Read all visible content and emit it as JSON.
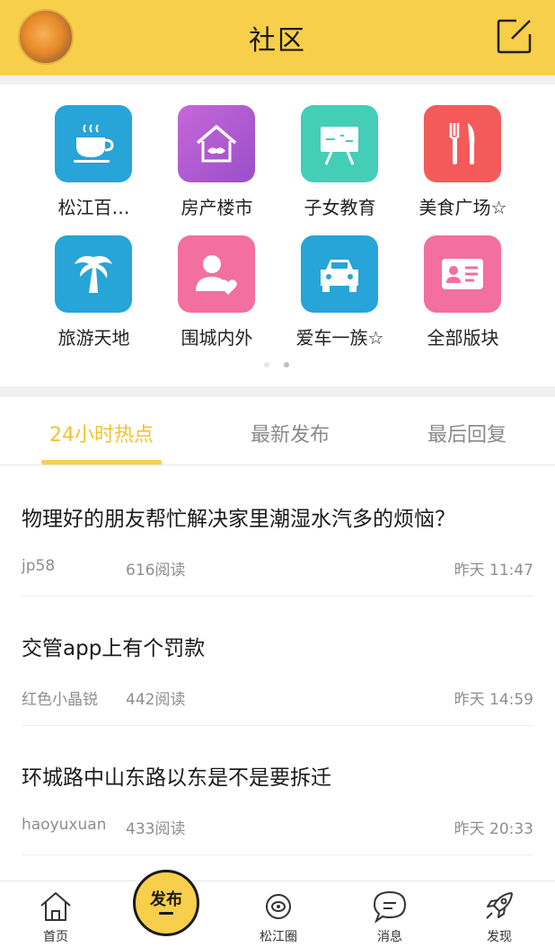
{
  "header": {
    "title": "社区"
  },
  "categories": [
    {
      "label": "松江百…",
      "icon": "tea-cup-icon",
      "color": "#27a4d8"
    },
    {
      "label": "房产楼市",
      "icon": "house-handshake-icon",
      "color": "#b45fd0"
    },
    {
      "label": "子女教育",
      "icon": "easel-icon",
      "color": "#44cdb7"
    },
    {
      "label": "美食广场☆",
      "icon": "fork-knife-icon",
      "color": "#f45a5a"
    },
    {
      "label": "旅游天地",
      "icon": "palm-tree-icon",
      "color": "#27a4d8"
    },
    {
      "label": "围城内外",
      "icon": "person-heart-icon",
      "color": "#f26f9f"
    },
    {
      "label": "爱车一族☆",
      "icon": "car-icon",
      "color": "#27a4d8"
    },
    {
      "label": "全部版块",
      "icon": "id-card-icon",
      "color": "#f26f9f"
    }
  ],
  "pager": {
    "page_count": 2,
    "active_index": 1
  },
  "tabs": [
    {
      "label": "24小时热点",
      "active": true
    },
    {
      "label": "最新发布",
      "active": false
    },
    {
      "label": "最后回复",
      "active": false
    }
  ],
  "posts": [
    {
      "title": "物理好的朋友帮忙解决家里潮湿水汽多的烦恼？",
      "author": "jp58",
      "reads": "616阅读",
      "time": "昨天 11:47"
    },
    {
      "title": "交管app上有个罚款",
      "author": "红色小晶锐",
      "reads": "442阅读",
      "time": "昨天 14:59"
    },
    {
      "title": "环城路中山东路以东是不是要拆迁",
      "author": "haoyuxuan",
      "reads": "433阅读",
      "time": "昨天 20:33"
    }
  ],
  "bottom_nav": [
    {
      "label": "首页",
      "icon": "home-icon"
    },
    {
      "label": "发布",
      "icon": "publish-icon"
    },
    {
      "label": "松江圈",
      "icon": "planet-icon"
    },
    {
      "label": "消息",
      "icon": "chat-bubble-icon"
    },
    {
      "label": "发现",
      "icon": "rocket-icon"
    }
  ],
  "colors": {
    "accent": "#f8cf4a",
    "active_tab_text": "#f2c230"
  }
}
